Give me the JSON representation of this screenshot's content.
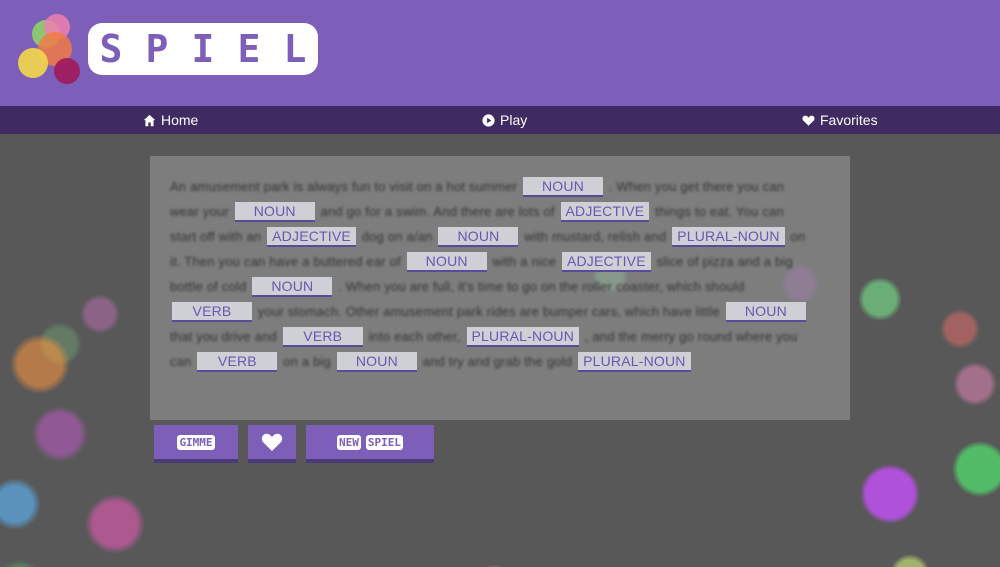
{
  "app": {
    "logo_text": "SPIEL",
    "logo_letters": [
      "S",
      "P",
      "I",
      "E",
      "L"
    ]
  },
  "nav": {
    "items": [
      {
        "label": "Home",
        "icon": "home-icon"
      },
      {
        "label": "Play",
        "icon": "play-icon"
      },
      {
        "label": "Favorites",
        "icon": "heart-icon"
      }
    ]
  },
  "story": {
    "segments": [
      {
        "text": "An amusement park is always fun to visit on a hot summer"
      },
      {
        "blank": "NOUN"
      },
      {
        "text": ". When you get there you can wear your"
      },
      {
        "blank": "NOUN"
      },
      {
        "text": "and go for a swim. And there are lots of"
      },
      {
        "blank": "ADJECTIVE"
      },
      {
        "text": "things to eat. You can start off with an"
      },
      {
        "blank": "ADJECTIVE"
      },
      {
        "text": "dog on a/an"
      },
      {
        "blank": "NOUN"
      },
      {
        "text": "with mustard, relish and"
      },
      {
        "blank": "PLURAL-NOUN"
      },
      {
        "text": "on it. Then you can have a buttered ear of"
      },
      {
        "blank": "NOUN"
      },
      {
        "text": "with a nice"
      },
      {
        "blank": "ADJECTIVE"
      },
      {
        "text": "slice of pizza and a big bottle of cold"
      },
      {
        "blank": "NOUN"
      },
      {
        "text": ". When you are full, it's time to go on the roller coaster, which should"
      },
      {
        "blank": "VERB"
      },
      {
        "text": "your stomach. Other amusement park rides are bumper cars, which have little"
      },
      {
        "blank": "NOUN"
      },
      {
        "text": "that you drive and"
      },
      {
        "blank": "VERB"
      },
      {
        "text": "into each other,"
      },
      {
        "blank": "PLURAL-NOUN"
      },
      {
        "text": ", and the merry go round where you can"
      },
      {
        "blank": "VERB"
      },
      {
        "text": "on a big"
      },
      {
        "blank": "NOUN"
      },
      {
        "text": "and try and grab the gold"
      },
      {
        "blank": "PLURAL-NOUN"
      }
    ]
  },
  "actions": {
    "gimme_label": "GIMME",
    "favorite_icon": "heart-icon",
    "new_spiel_label": "NEW SPIEL"
  },
  "colors": {
    "brand_purple": "#7d5fba",
    "nav_dark": "#3f2a62",
    "blank_text": "#6a56b0"
  }
}
